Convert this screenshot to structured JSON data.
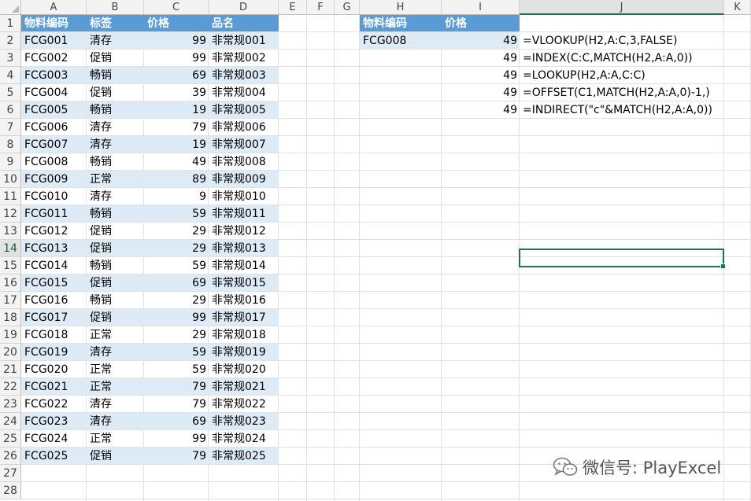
{
  "columns": [
    "A",
    "B",
    "C",
    "D",
    "E",
    "F",
    "G",
    "H",
    "I",
    "J",
    "K"
  ],
  "active_column": "J",
  "active_row": "14",
  "theme": {
    "header_fill": "#5b9bd5",
    "band_fill": "#ddebf7",
    "selection_green": "#217346"
  },
  "table_main": {
    "headers": [
      "物料编码",
      "标签",
      "价格",
      "品名"
    ],
    "rows": [
      [
        "FCG001",
        "清存",
        "99",
        "非常规001"
      ],
      [
        "FCG002",
        "促销",
        "99",
        "非常规002"
      ],
      [
        "FCG003",
        "畅销",
        "69",
        "非常规003"
      ],
      [
        "FCG004",
        "促销",
        "39",
        "非常规004"
      ],
      [
        "FCG005",
        "畅销",
        "19",
        "非常规005"
      ],
      [
        "FCG006",
        "清存",
        "79",
        "非常规006"
      ],
      [
        "FCG007",
        "清存",
        "19",
        "非常规007"
      ],
      [
        "FCG008",
        "畅销",
        "49",
        "非常规008"
      ],
      [
        "FCG009",
        "正常",
        "89",
        "非常规009"
      ],
      [
        "FCG010",
        "清存",
        "9",
        "非常规010"
      ],
      [
        "FCG011",
        "畅销",
        "59",
        "非常规011"
      ],
      [
        "FCG012",
        "促销",
        "29",
        "非常规012"
      ],
      [
        "FCG013",
        "促销",
        "29",
        "非常规013"
      ],
      [
        "FCG014",
        "畅销",
        "59",
        "非常规014"
      ],
      [
        "FCG015",
        "促销",
        "69",
        "非常规015"
      ],
      [
        "FCG016",
        "畅销",
        "29",
        "非常规016"
      ],
      [
        "FCG017",
        "促销",
        "99",
        "非常规017"
      ],
      [
        "FCG018",
        "正常",
        "29",
        "非常规018"
      ],
      [
        "FCG019",
        "清存",
        "59",
        "非常规019"
      ],
      [
        "FCG020",
        "正常",
        "59",
        "非常规020"
      ],
      [
        "FCG021",
        "正常",
        "79",
        "非常规021"
      ],
      [
        "FCG022",
        "清存",
        "79",
        "非常规022"
      ],
      [
        "FCG023",
        "清存",
        "69",
        "非常规023"
      ],
      [
        "FCG024",
        "正常",
        "99",
        "非常规024"
      ],
      [
        "FCG025",
        "促销",
        "79",
        "非常规025"
      ]
    ]
  },
  "lookup_table": {
    "headers": [
      "物料编码",
      "价格"
    ],
    "code": "FCG008",
    "result": "49"
  },
  "lookup_results": [
    {
      "value": "49",
      "formula": "=VLOOKUP(H2,A:C,3,FALSE)"
    },
    {
      "value": "49",
      "formula": "=INDEX(C:C,MATCH(H2,A:A,0))"
    },
    {
      "value": "49",
      "formula": "=LOOKUP(H2,A:A,C:C)"
    },
    {
      "value": "49",
      "formula": "=OFFSET(C1,MATCH(H2,A:A,0)-1,)"
    },
    {
      "value": "49",
      "formula": "=INDIRECT(\"c\"&MATCH(H2,A:A,0))"
    }
  ],
  "watermark": {
    "icon": "wechat-icon",
    "text": "微信号: PlayExcel"
  }
}
